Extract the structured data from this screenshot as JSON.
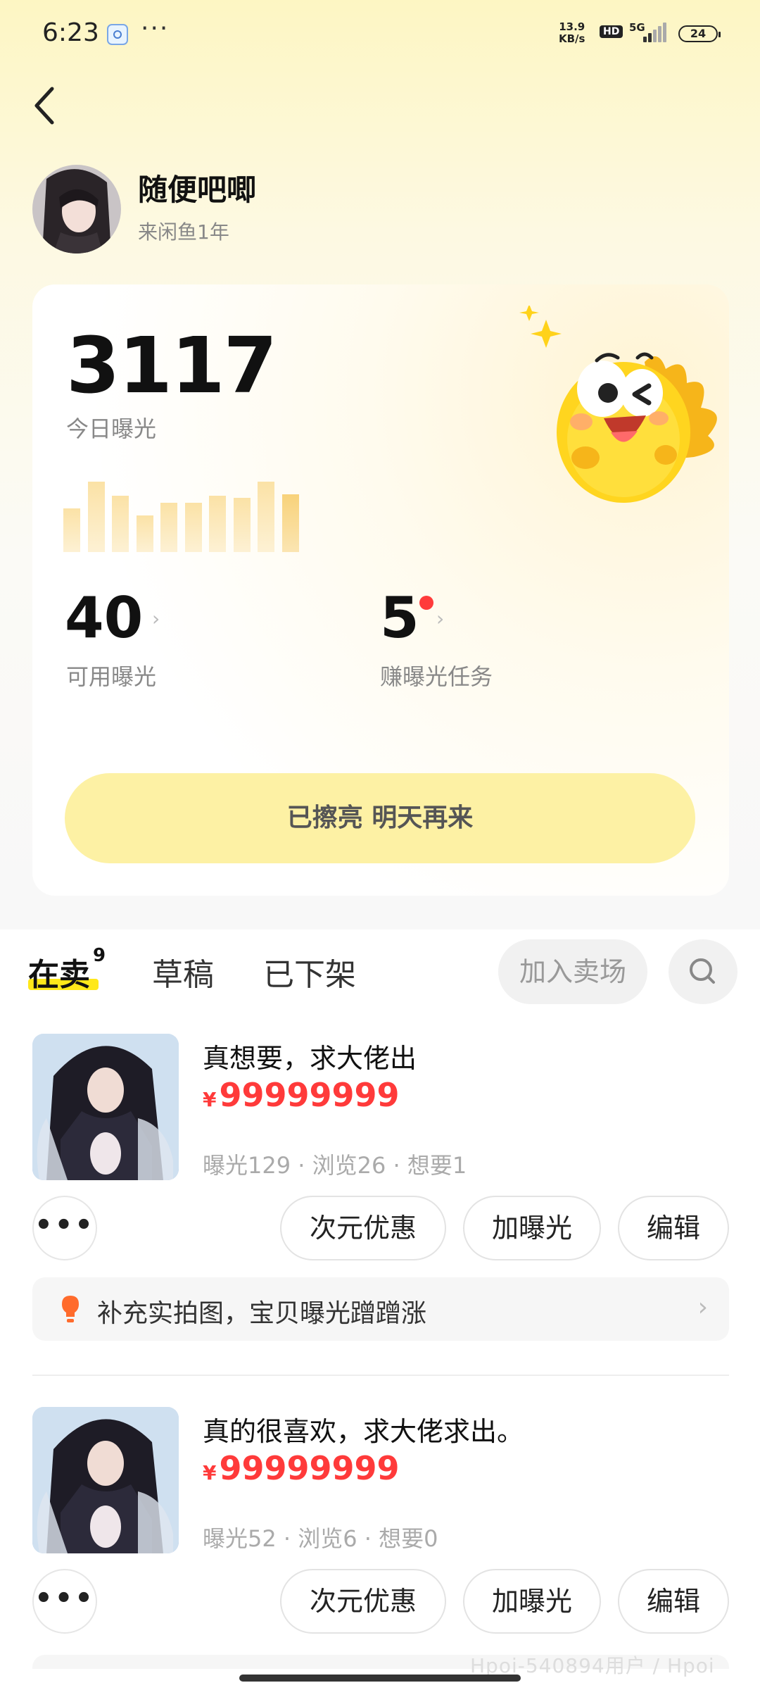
{
  "status_bar": {
    "time": "6:23",
    "dots": "···",
    "speed_value": "13.9",
    "speed_unit": "KB/s",
    "hd": "HD",
    "network": "5G",
    "battery": "24"
  },
  "icons": {
    "back": "chevron-left-icon",
    "search": "search-icon",
    "more": "more-dots-icon",
    "tip": "lightbulb-icon",
    "tip_arrow": "chevron-right-icon"
  },
  "profile": {
    "name": "随便吧唧",
    "subtitle": "来闲鱼1年"
  },
  "exposure": {
    "today_value": "3117",
    "today_label": "今日曝光",
    "trend": [
      0.62,
      1.0,
      0.8,
      0.52,
      0.7,
      0.7,
      0.8,
      0.77,
      1.0,
      0.82
    ],
    "available_value": "40",
    "available_label": "可用曝光",
    "tasks_value": "5",
    "tasks_label": "赚曝光任务",
    "arrow": "›",
    "polish_button": "已擦亮 明天再来"
  },
  "tabs": {
    "selling": "在卖",
    "selling_count": "9",
    "drafts": "草稿",
    "removed": "已下架",
    "join_button": "加入卖场"
  },
  "products": [
    {
      "title": "真想要，求大佬出",
      "currency": "¥",
      "price": "99999999",
      "meta": "曝光129 · 浏览26 · 想要1",
      "more": "•••",
      "btn_discount": "次元优惠",
      "btn_boost": "加曝光",
      "btn_edit": "编辑",
      "tip": "补充实拍图，宝贝曝光蹭蹭涨",
      "tip_arrow": "›"
    },
    {
      "title": "真的很喜欢，求大佬求出。",
      "currency": "¥",
      "price": "99999999",
      "meta": "曝光52 · 浏览6 · 想要0",
      "more": "•••",
      "btn_discount": "次元优惠",
      "btn_boost": "加曝光",
      "btn_edit": "编辑"
    }
  ],
  "watermark": "Hpoi-540894用户 / Hpoi"
}
